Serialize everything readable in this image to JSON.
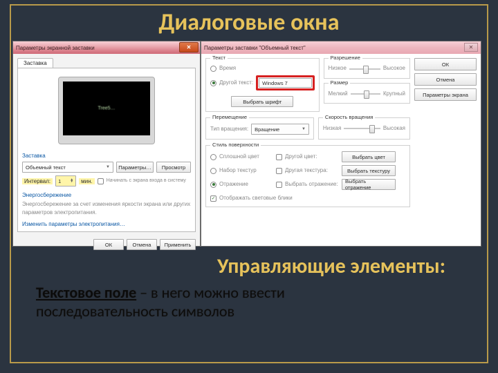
{
  "slide": {
    "title": "Диалоговые окна",
    "subtitle": "Управляющие элементы:",
    "body_bold": "Текстовое поле",
    "body_rest1": " – в него можно ввести",
    "body_rest2": "последовательность символов"
  },
  "dlg1": {
    "title": "Параметры экранной заставки",
    "tab": "Заставка",
    "screen_text": "Tree5…",
    "section_screensaver": "Заставка",
    "combo_value": "Объемный текст",
    "btn_params": "Параметры…",
    "btn_preview": "Просмотр",
    "interval_label": "Интервал:",
    "interval_value": "1",
    "interval_unit": "мин.",
    "resume_check": "Начинать с экрана входа в систему",
    "power_section": "Энергосбережение",
    "power_text": "Энергосбережение за счет изменения яркости экрана или других параметров электропитания.",
    "power_link": "Изменить параметры электропитания…",
    "ok": "ОК",
    "cancel": "Отмена",
    "apply": "Применить"
  },
  "dlg2": {
    "title": "Параметры заставки \"Объемный текст\"",
    "grp_text": "Текст",
    "radio_time": "Время",
    "radio_custom": "Другой текст:",
    "custom_value": "Windows 7",
    "btn_font": "Выбрать шрифт",
    "grp_resolution": "Разрешение",
    "res_low": "Низкое",
    "res_high": "Высокое",
    "grp_size": "Размер",
    "size_small": "Мелкий",
    "size_large": "Крупный",
    "grp_motion": "Перемещение",
    "motion_type_label": "Тип вращения:",
    "motion_type_value": "Вращение",
    "grp_speed": "Скорость вращения",
    "speed_low": "Низкая",
    "speed_high": "Высокая",
    "grp_surface": "Стиль поверхности",
    "surf_solid": "Сплошной цвет",
    "surf_solid_chk": "Другой цвет:",
    "surf_solid_btn": "Выбрать цвет",
    "surf_texture": "Набор текстур",
    "surf_texture_chk": "Другая текстура:",
    "surf_texture_btn": "Выбрать текстуру",
    "surf_reflect": "Отражение",
    "surf_reflect_chk": "Выбрать отражение:",
    "surf_reflect_btn": "Выбрать отражение",
    "show_glare": "Отображать световые блики",
    "ok": "ОК",
    "cancel": "Отмена",
    "display_params": "Параметры экрана"
  }
}
